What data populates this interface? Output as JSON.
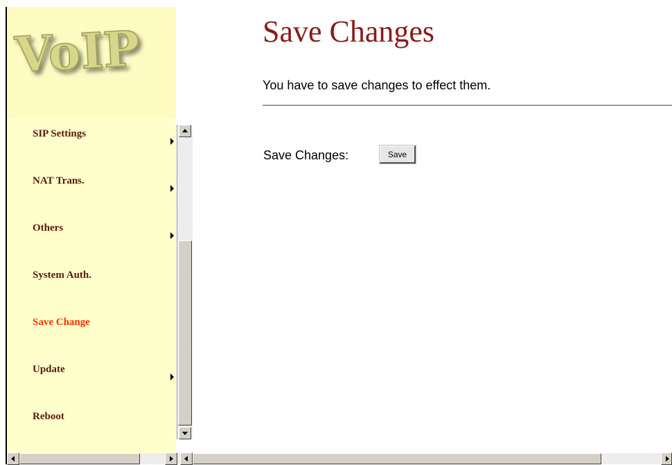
{
  "logo": {
    "text": "VoIP"
  },
  "sidebar": {
    "items": [
      {
        "label": "SIP Settings",
        "has_submenu": true
      },
      {
        "label": "NAT Trans.",
        "has_submenu": true
      },
      {
        "label": "Others",
        "has_submenu": true
      },
      {
        "label": "System Auth.",
        "has_submenu": false
      },
      {
        "label": "Save Change",
        "has_submenu": false,
        "active": true
      },
      {
        "label": "Update",
        "has_submenu": true
      },
      {
        "label": "Reboot",
        "has_submenu": false
      }
    ]
  },
  "main": {
    "title": "Save Changes",
    "subtitle": "You have to save changes to effect them.",
    "save_label": "Save Changes:",
    "save_button": "Save"
  },
  "colors": {
    "sidebar_bg": "#ffffcc",
    "nav_text": "#5a1a0a",
    "nav_active": "#ff3300",
    "title": "#8b1a1a"
  }
}
